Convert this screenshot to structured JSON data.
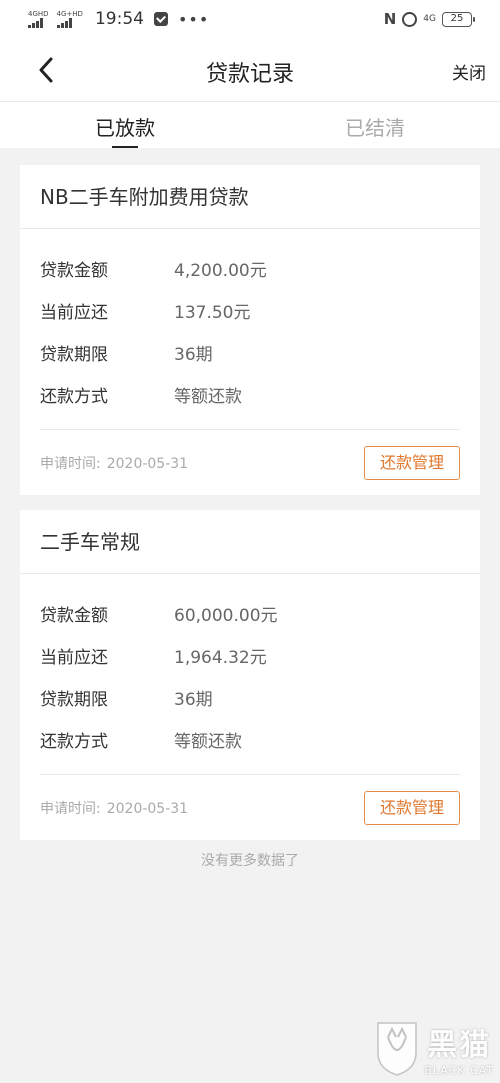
{
  "status_bar": {
    "sim1": "4GHD",
    "sim2": "4G+HD",
    "time": "19:54",
    "more": "•••",
    "net": "4G",
    "battery": "25"
  },
  "nav": {
    "title": "贷款记录",
    "close_label": "关闭"
  },
  "tabs": [
    {
      "label": "已放款",
      "active": true
    },
    {
      "label": "已结清",
      "active": false
    }
  ],
  "loans": [
    {
      "title": "NB二手车附加费用贷款",
      "rows": [
        {
          "label": "贷款金额",
          "value": "4,200.00元"
        },
        {
          "label": "当前应还",
          "value": "137.50元"
        },
        {
          "label": "贷款期限",
          "value": "36期"
        },
        {
          "label": "还款方式",
          "value": "等额还款"
        }
      ],
      "apply_label": "申请时间:",
      "apply_date": "2020-05-31",
      "button_label": "还款管理"
    },
    {
      "title": "二手车常规",
      "rows": [
        {
          "label": "贷款金额",
          "value": "60,000.00元"
        },
        {
          "label": "当前应还",
          "value": "1,964.32元"
        },
        {
          "label": "贷款期限",
          "value": "36期"
        },
        {
          "label": "还款方式",
          "value": "等额还款"
        }
      ],
      "apply_label": "申请时间:",
      "apply_date": "2020-05-31",
      "button_label": "还款管理"
    }
  ],
  "footer_text": "没有更多数据了",
  "watermark": {
    "cn": "黑猫",
    "en": "BLACK CAT"
  }
}
